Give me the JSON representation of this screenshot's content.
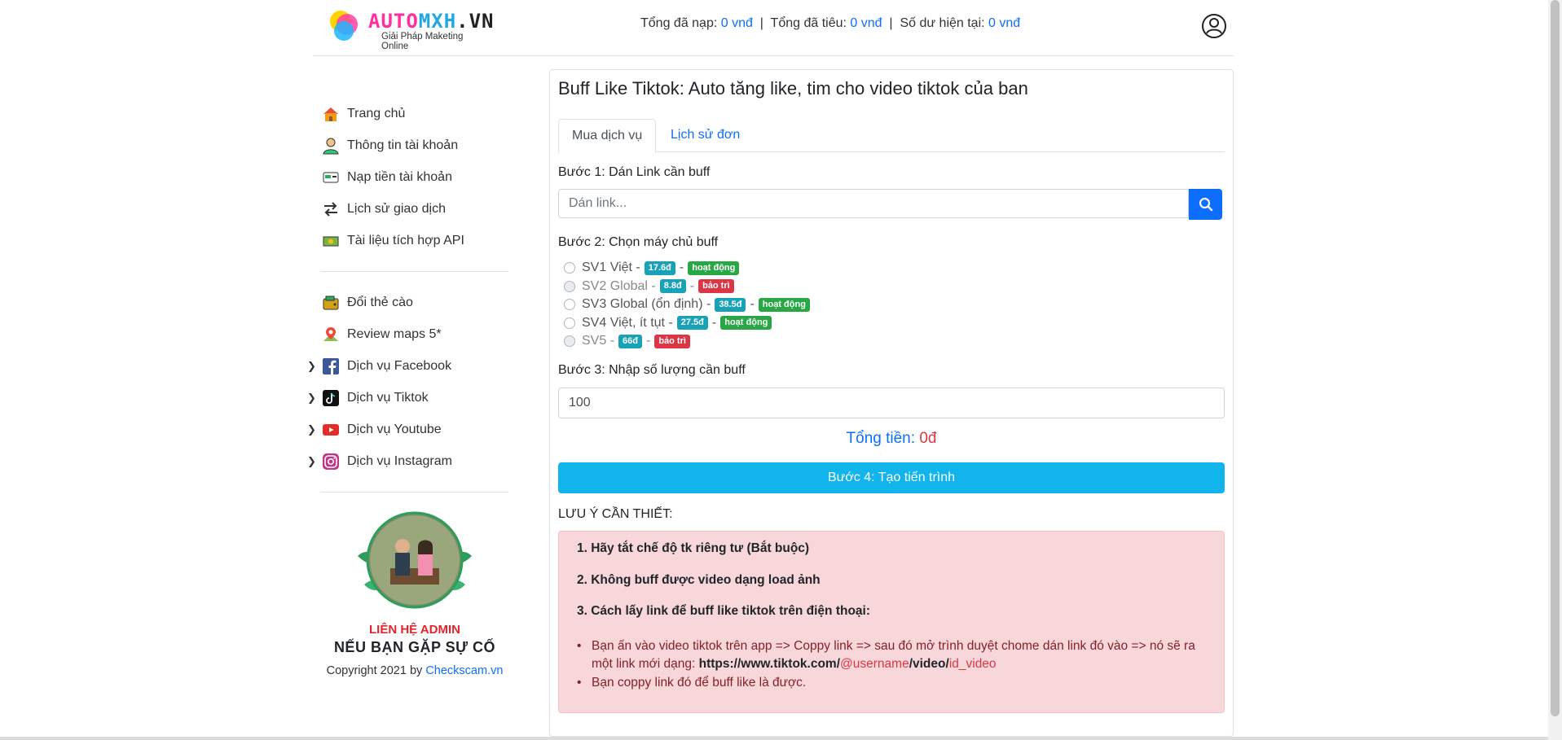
{
  "header": {
    "logo_text": "AUTOMXH.VN",
    "logo_sub": "Giải Pháp Maketing Online",
    "deposit_label": "Tổng đã nạp: ",
    "deposit_value": "0 vnđ",
    "spent_label": "Tổng đã tiêu: ",
    "spent_value": "0 vnđ",
    "balance_label": "Số dư hiện tại: ",
    "balance_value": "0 vnđ",
    "sep": "|"
  },
  "sidebar": {
    "items": [
      {
        "label": "Trang chủ",
        "icon": "home-icon"
      },
      {
        "label": "Thông tin tài khoản",
        "icon": "user-icon"
      },
      {
        "label": "Nạp tiền tài khoản",
        "icon": "deposit-icon"
      },
      {
        "label": "Lịch sử giao dịch",
        "icon": "transfer-icon"
      },
      {
        "label": "Tài liệu tích hợp API",
        "icon": "api-icon"
      }
    ],
    "items2": [
      {
        "label": "Đổi thẻ cào",
        "icon": "wallet-icon"
      },
      {
        "label": "Review maps 5*",
        "icon": "map-pin-icon"
      },
      {
        "label": "Dịch vụ Facebook",
        "icon": "facebook-icon"
      },
      {
        "label": "Dịch vụ Tiktok",
        "icon": "tiktok-icon"
      },
      {
        "label": "Dịch vụ Youtube",
        "icon": "youtube-icon"
      },
      {
        "label": "Dịch vụ Instagram",
        "icon": "instagram-icon"
      }
    ],
    "contact": "LIÊN HỆ ADMIN",
    "issue": "NẾU BẠN GẶP SỰ CỐ",
    "copyright": "Copyright 2021 by ",
    "copyright_link": "Checkscam.vn"
  },
  "main": {
    "title": "Buff Like Tiktok: Auto tăng like, tim cho video tiktok của ban",
    "tabs": [
      {
        "label": "Mua dịch vụ",
        "active": true
      },
      {
        "label": "Lịch sử đơn",
        "active": false
      }
    ],
    "step1": "Bước 1: Dán Link cần buff",
    "link_placeholder": "Dán link...",
    "step2": "Bước 2: Chọn máy chủ buff",
    "servers": [
      {
        "name": "SV1 Việt -",
        "price": "17.6đ",
        "status": "hoạt động",
        "ok": true
      },
      {
        "name": "SV2 Global -",
        "price": "8.8đ",
        "status": "bảo trì",
        "ok": false
      },
      {
        "name": "SV3 Global (ổn định) -",
        "price": "38.5đ",
        "status": "hoạt động",
        "ok": true
      },
      {
        "name": "SV4 Việt, ít tụt -",
        "price": "27.5đ",
        "status": "hoạt động",
        "ok": true
      },
      {
        "name": "SV5 -",
        "price": "66đ",
        "status": "bảo trì",
        "ok": false
      }
    ],
    "step3": "Bước 3: Nhập số lượng cần buff",
    "quantity": "100",
    "total_label": "Tổng tiền: ",
    "total_value": "0đ",
    "create_button": "Bước 4: Tạo tiến trình",
    "note_title": "LƯU Ý CẦN THIẾT:",
    "notes": [
      "1. Hãy tắt chế độ tk riêng tư (Bắt buộc)",
      "2. Không buff được video dạng load ảnh",
      "3. Cách lấy link để buff like tiktok trên điện thoại:"
    ],
    "bullet1_text": "Bạn ấn vào video tiktok trên app  => Coppy link => sau đó mở trình duyệt chome dán link đó vào => nó sẽ ra một link mới dạng: ",
    "bullet1_url_a": "https://www.tiktok.com/",
    "bullet1_url_b": "@username",
    "bullet1_url_c": "/video/",
    "bullet1_url_d": "id_video",
    "bullet2_text": "Bạn coppy link đó để buff like là được."
  },
  "colors": {
    "primary": "#0d6efd",
    "accent": "#11b5ec",
    "danger": "#dc3545",
    "success": "#28a745",
    "info": "#17a2b8"
  }
}
